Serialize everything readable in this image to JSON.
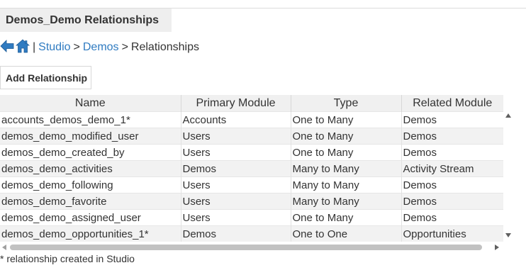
{
  "page": {
    "title": "Demos_Demo Relationships"
  },
  "breadcrumb": {
    "back_icon": "back-arrow-icon",
    "home_icon": "home-icon",
    "separator": "|",
    "studio": "Studio",
    "arrow1": ">",
    "module": "Demos",
    "arrow2": ">",
    "current": "Relationships"
  },
  "toolbar": {
    "add_label": "Add Relationship"
  },
  "table": {
    "columns": [
      "Name",
      "Primary Module",
      "Type",
      "Related Module"
    ],
    "rows": [
      [
        "accounts_demos_demo_1*",
        "Accounts",
        "One to Many",
        "Demos"
      ],
      [
        "demos_demo_modified_user",
        "Users",
        "One to Many",
        "Demos"
      ],
      [
        "demos_demo_created_by",
        "Users",
        "One to Many",
        "Demos"
      ],
      [
        "demos_demo_activities",
        "Demos",
        "Many to Many",
        "Activity Stream"
      ],
      [
        "demos_demo_following",
        "Users",
        "Many to Many",
        "Demos"
      ],
      [
        "demos_demo_favorite",
        "Users",
        "Many to Many",
        "Demos"
      ],
      [
        "demos_demo_assigned_user",
        "Users",
        "One to Many",
        "Demos"
      ],
      [
        "demos_demo_opportunities_1*",
        "Demos",
        "One to One",
        "Opportunities"
      ]
    ]
  },
  "footnote": "* relationship created in Studio",
  "colors": {
    "link": "#2f7bc1",
    "header_bg": "#f0f0f0",
    "alt_row": "#f2f2f2",
    "tab_bg": "#eeeeee"
  }
}
